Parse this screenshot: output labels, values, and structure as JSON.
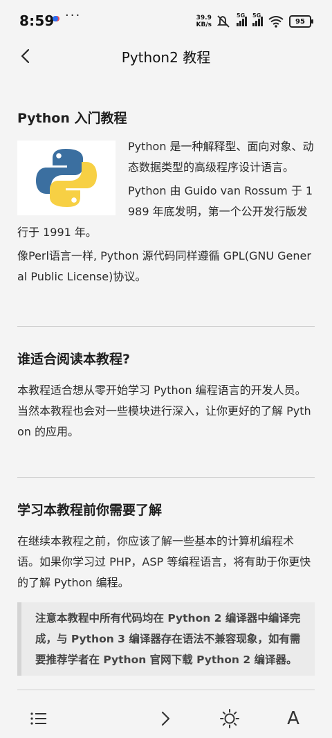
{
  "status": {
    "time": "8:59",
    "net_speed_value": "39.9",
    "net_speed_unit": "KB/s",
    "signal_label_1": "5G",
    "signal_label_2": "5G",
    "battery": "95"
  },
  "header": {
    "title": "Python2 教程"
  },
  "content": {
    "intro": {
      "title": "Python 入门教程",
      "p1": "Python 是一种解释型、面向对象、动态数据类型的高级程序设计语言。",
      "p2": "Python 由 Guido van Rossum 于 1989 年底发明，第一个公开发行版发行于 1991 年。",
      "p3": "像Perl语言一样, Python 源代码同样遵循 GPL(GNU General Public License)协议。"
    },
    "audience": {
      "title": "谁适合阅读本教程?",
      "p1": "本教程适合想从零开始学习 Python 编程语言的开发人员。当然本教程也会对一些模块进行深入，让你更好的了解 Python 的应用。"
    },
    "prereq": {
      "title": "学习本教程前你需要了解",
      "p1": "在继续本教程之前，你应该了解一些基本的计算机编程术语。如果你学习过 PHP，ASP 等编程语言，将有助于你更快的了解 Python 编程。",
      "note": "注意本教程中所有代码均在 Python 2 编译器中编译完成，与 Python 3 编译器存在语法不兼容现象，如有需要推荐学者在 Python 官网下载 Python 2 编译器。"
    }
  },
  "bottom_bar": {
    "font_label": "A"
  },
  "colors": {
    "background": "#f4f4f4",
    "python_blue": "#3b6fa0",
    "python_yellow": "#f7d044",
    "divider": "#cfcfcf"
  },
  "icons": {
    "back": "chevron-left-icon",
    "menu": "list-icon",
    "next": "chevron-right-icon",
    "brightness": "sun-icon",
    "font": "font-size-icon",
    "logo": "python-logo-icon"
  }
}
